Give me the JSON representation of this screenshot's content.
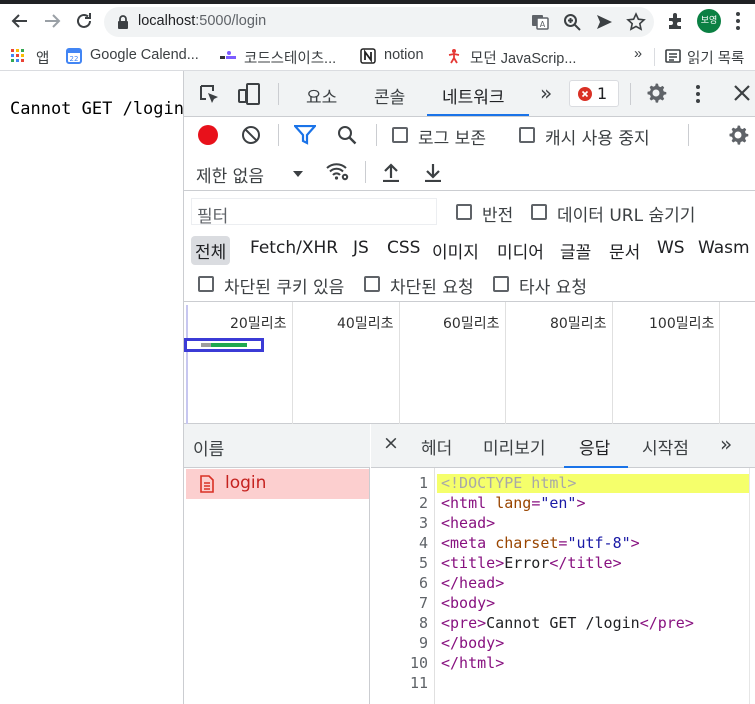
{
  "browser": {
    "url_host": "localhost",
    "url_path": ":5000/login",
    "profile_label": "보영",
    "bookmarks": [
      {
        "label": "앱"
      },
      {
        "label": "Google Calend..."
      },
      {
        "label": "코드스테이츠..."
      },
      {
        "label": "notion"
      },
      {
        "label": "모던 JavaScrip..."
      }
    ],
    "overflow_label": "»",
    "reading_list_label": "읽기 목록"
  },
  "page": {
    "body_text": "Cannot GET /login"
  },
  "devtools": {
    "tabs": [
      {
        "label": "요소"
      },
      {
        "label": "콘솔"
      },
      {
        "label": "네트워크"
      }
    ],
    "more_label": "»",
    "error_count": "1",
    "toolbar": {
      "preserve_log_label": "로그 보존",
      "disable_cache_label": "캐시 사용 중지",
      "throttle_label": "제한 없음"
    },
    "filter": {
      "placeholder": "필터",
      "invert_label": "반전",
      "hide_data_urls_label": "데이터 URL 숨기기"
    },
    "types": [
      {
        "label": "전체"
      },
      {
        "label": "Fetch/XHR"
      },
      {
        "label": "JS"
      },
      {
        "label": "CSS"
      },
      {
        "label": "이미지"
      },
      {
        "label": "미디어"
      },
      {
        "label": "글꼴"
      },
      {
        "label": "문서"
      },
      {
        "label": "WS"
      },
      {
        "label": "Wasm"
      }
    ],
    "blocked_cookies_label": "차단된 쿠키 있음",
    "blocked_requests_label": "차단된 요청",
    "third_party_label": "타사 요청",
    "timeline_ticks": [
      {
        "label": "20밀리초"
      },
      {
        "label": "40밀리초"
      },
      {
        "label": "60밀리초"
      },
      {
        "label": "80밀리초"
      },
      {
        "label": "100밀리초"
      }
    ],
    "name_header": "이름",
    "requests": [
      {
        "name": "login"
      }
    ],
    "detail_close": "×",
    "detail_tabs": [
      {
        "label": "헤더"
      },
      {
        "label": "미리보기"
      },
      {
        "label": "응답"
      },
      {
        "label": "시작점"
      }
    ],
    "detail_more": "»",
    "response_lines": [
      {
        "num": "1",
        "text": "<!DOCTYPE html>"
      },
      {
        "num": "2",
        "text": "<html lang=\"en\">"
      },
      {
        "num": "3",
        "text": "<head>"
      },
      {
        "num": "4",
        "text": "<meta charset=\"utf-8\">"
      },
      {
        "num": "5",
        "text": "<title>Error</title>"
      },
      {
        "num": "6",
        "text": "</head>"
      },
      {
        "num": "7",
        "text": "<body>"
      },
      {
        "num": "8",
        "text": "<pre>Cannot GET /login</pre>"
      },
      {
        "num": "9",
        "text": "</body>"
      },
      {
        "num": "10",
        "text": "</html>"
      },
      {
        "num": "11",
        "text": ""
      }
    ]
  },
  "colors": {
    "accent": "#1a73e8",
    "record": "#e8111b",
    "error_row": "#fccfcf",
    "line_highlight": "#f5ff6b"
  }
}
